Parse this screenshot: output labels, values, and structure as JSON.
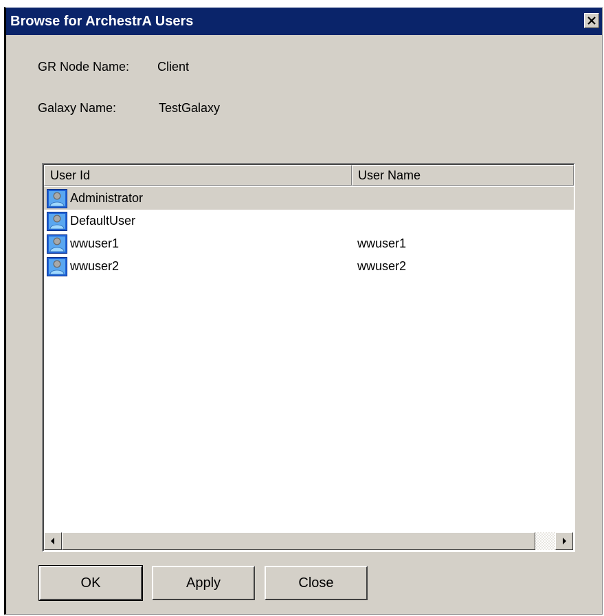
{
  "window": {
    "title": "Browse for ArchestrA Users"
  },
  "info": {
    "node_label": "GR Node Name:",
    "node_value": "Client",
    "galaxy_label": "Galaxy Name:",
    "galaxy_value": "TestGalaxy"
  },
  "list": {
    "columns": [
      "User Id",
      "User Name"
    ],
    "rows": [
      {
        "user_id": "Administrator",
        "user_name": "",
        "selected": true
      },
      {
        "user_id": "DefaultUser",
        "user_name": "",
        "selected": false
      },
      {
        "user_id": "wwuser1",
        "user_name": "wwuser1",
        "selected": false
      },
      {
        "user_id": "wwuser2",
        "user_name": "wwuser2",
        "selected": false
      }
    ],
    "row_icon": "user-icon"
  },
  "buttons": {
    "ok": "OK",
    "apply": "Apply",
    "close": "Close"
  },
  "colors": {
    "titlebar": "#0a246a",
    "face": "#d4d0c8",
    "selection": "#d4d0c8"
  }
}
